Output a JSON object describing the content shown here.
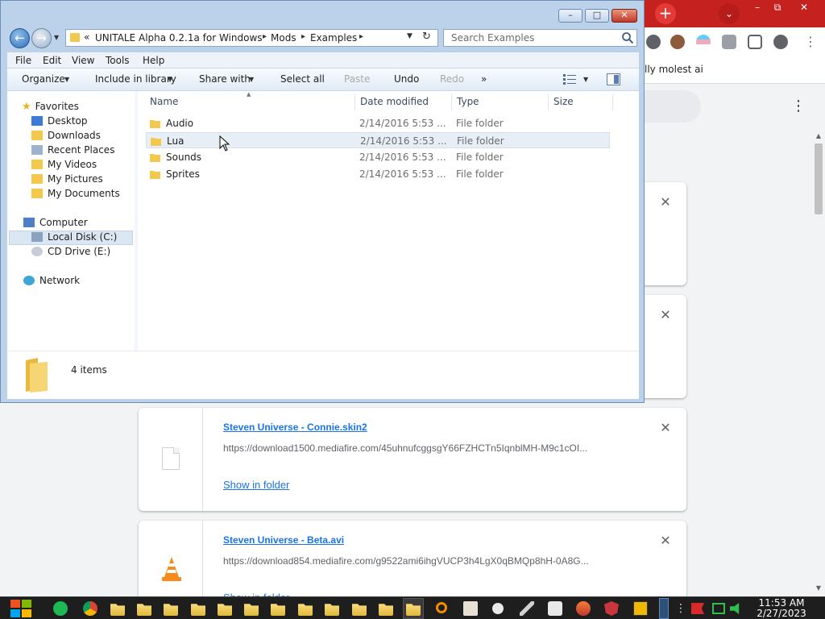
{
  "chrome": {
    "newtab_glyph": "+",
    "tabsearch_glyph": "⌄",
    "window_controls": {
      "minimize": "–",
      "restore": "⧉",
      "close": "✕"
    },
    "bookmark_text": "lly molest ai",
    "menu_glyph": "⋮",
    "downloads": [
      {
        "name": "",
        "url": "",
        "show": ""
      },
      {
        "name": "",
        "url": "",
        "show": ""
      },
      {
        "name": "Steven Universe - Connie.skin2",
        "url": "https://download1500.mediafire.com/45uhnufcggsgY66FZHCTn5IqnblMH-M9c1cOI...",
        "show": "Show in folder",
        "icon": "file-icon"
      },
      {
        "name": "Steven Universe - Beta.avi",
        "url": "https://download854.mediafire.com/g9522ami6ihgVUCP3h4LgX0qBMQp8hH-0A8G...",
        "show": "Show in folder",
        "icon": "vlc-icon"
      }
    ],
    "close_glyph": "✕"
  },
  "explorer": {
    "caption": {
      "minimize": "–",
      "maximize": "□",
      "close": "✕"
    },
    "nav": {
      "back": "←",
      "forward": "→",
      "recent": "▼"
    },
    "address": {
      "overflow": "«",
      "crumbs": [
        "UNITALE Alpha 0.2.1a for Windows",
        "Mods",
        "Examples"
      ],
      "separator": "▸",
      "dropdown": "▼",
      "refresh": "↻"
    },
    "search_placeholder": "Search Examples",
    "menu": [
      "File",
      "Edit",
      "View",
      "Tools",
      "Help"
    ],
    "commands": {
      "organize": "Organize",
      "include": "Include in library",
      "share": "Share with",
      "select_all": "Select all",
      "paste": "Paste",
      "undo": "Undo",
      "redo": "Redo",
      "more": "»",
      "dropdown": "▼"
    },
    "nav_pane": {
      "favorites": "Favorites",
      "favorites_items": [
        "Desktop",
        "Downloads",
        "Recent Places",
        "My Videos",
        "My Pictures",
        "My Documents"
      ],
      "computer": "Computer",
      "computer_items": [
        "Local Disk (C:)",
        "CD Drive (E:)"
      ],
      "network": "Network"
    },
    "columns": [
      "Name",
      "Date modified",
      "Type",
      "Size"
    ],
    "sort_glyph": "▲",
    "files": [
      {
        "name": "Audio",
        "date": "2/14/2016 5:53 ...",
        "type": "File folder",
        "size": ""
      },
      {
        "name": "Lua",
        "date": "2/14/2016 5:53 ...",
        "type": "File folder",
        "size": ""
      },
      {
        "name": "Sounds",
        "date": "2/14/2016 5:53 ...",
        "type": "File folder",
        "size": ""
      },
      {
        "name": "Sprites",
        "date": "2/14/2016 5:53 ...",
        "type": "File folder",
        "size": ""
      }
    ],
    "item_count": "4 items"
  },
  "taskbar": {
    "time": "11:53 AM",
    "date": "2/27/2023"
  },
  "colors": {
    "chrome_titlebar": "#c5221f",
    "explorer_frame": "#bcd2ea",
    "link": "#1a73e8",
    "folder": "#f2c94c"
  }
}
